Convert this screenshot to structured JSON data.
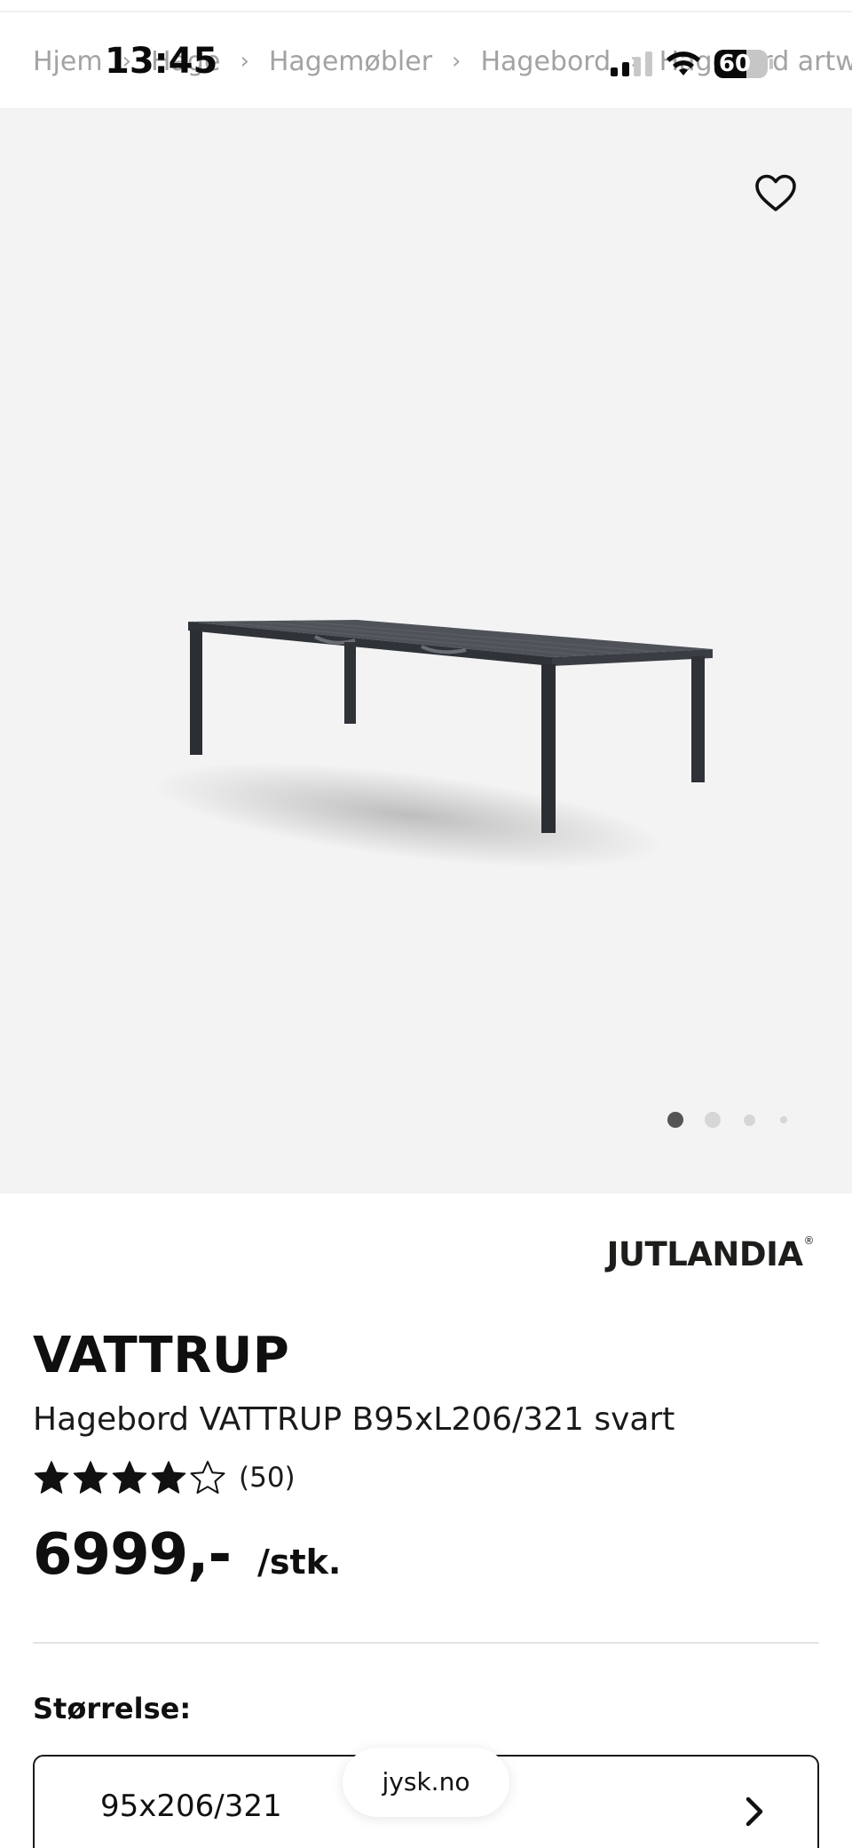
{
  "status_bar": {
    "time": "13:45",
    "battery": "60",
    "battery_level": 0.6,
    "signal_bars_active": 2,
    "signal_bars_total": 4,
    "icons": [
      "signal-icon",
      "wifi-icon",
      "battery-icon"
    ]
  },
  "breadcrumb": {
    "items": [
      "Hjem",
      "Hage",
      "Hagemøbler",
      "Hagebord",
      "Hagebord artwood"
    ],
    "separator": "›"
  },
  "hero": {
    "wishlist_icon": "heart-outline-icon",
    "carousel": {
      "total": 4,
      "active": 1
    }
  },
  "product": {
    "brand": "JUTLANDIA",
    "brand_mark": "®",
    "title": "VATTRUP",
    "subtitle": "Hagebord VATTRUP B95xL206/321 svart",
    "rating": {
      "value": 4,
      "max": 5,
      "count_text": "(50)"
    },
    "price": "6999,-",
    "price_unit": "/stk."
  },
  "size": {
    "label": "Størrelse:",
    "selected": "95x206/321",
    "chevron_icon": "chevron-right-icon"
  },
  "browser": {
    "url": "jysk.no"
  },
  "colors": {
    "text": "#111111",
    "muted": "#a3a3a3",
    "hero_background": "#f3f3f3",
    "star_fill": "#111111",
    "dot_active": "#555555",
    "dot_inactive": "#d6d6d6"
  }
}
